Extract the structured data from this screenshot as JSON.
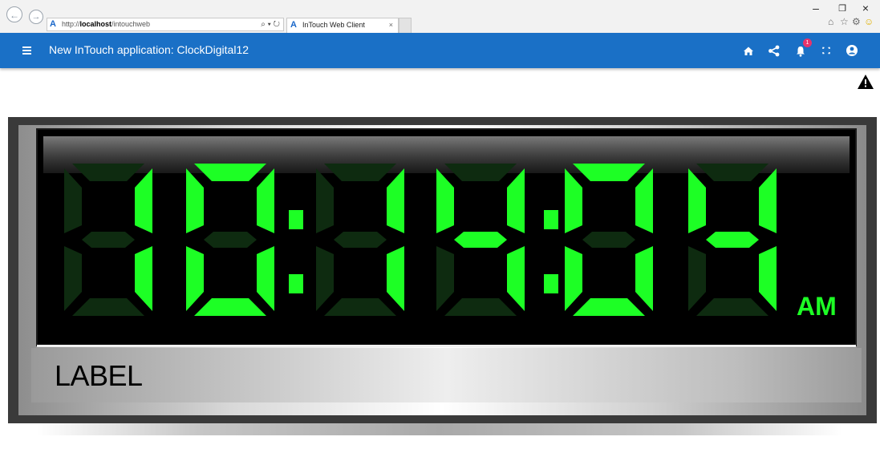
{
  "browser": {
    "back_icon": "arrow-left-icon",
    "forward_icon": "arrow-right-icon",
    "address_scheme": "http://",
    "address_host": "localhost",
    "address_path": "/intouchweb",
    "address_tools": "⌕ ▾ ↻",
    "tab_title": "InTouch Web Client",
    "tab_close": "×",
    "window_minimize": "–",
    "window_restore": "❐",
    "window_close": "×"
  },
  "appbar": {
    "title": "New InTouch application: ClockDigital12",
    "icons": [
      "home-icon",
      "share-icon",
      "notifications-icon",
      "fullscreen-icon",
      "account-icon"
    ],
    "notification_count": "1",
    "background": "#1a70c6"
  },
  "clock": {
    "time_digits": "10:14:04",
    "ampm": "AM",
    "label": "LABEL",
    "segment_on_color": "#1dff25",
    "segment_off_color": "#0e2b10",
    "frame_color": "#3a3a3a"
  }
}
